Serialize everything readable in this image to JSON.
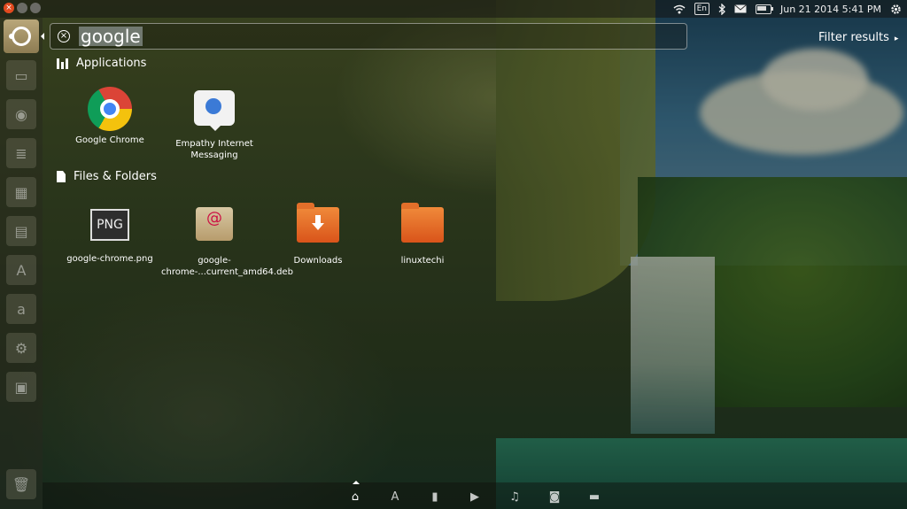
{
  "topbar": {
    "keyboard_layout": "En",
    "datetime": "Jun 21 2014  5:41 PM",
    "icons": [
      "wifi-icon",
      "keyboard-icon",
      "bluetooth-icon",
      "mail-icon",
      "battery-icon",
      "power-gear-icon"
    ]
  },
  "dash": {
    "search_query": "google",
    "filter_label": "Filter results"
  },
  "sections": {
    "applications": {
      "title": "Applications",
      "items": [
        {
          "label": "Google Chrome",
          "icon": "chrome-icon"
        },
        {
          "label": "Empathy Internet Messaging",
          "icon": "empathy-icon"
        }
      ]
    },
    "files": {
      "title": "Files & Folders",
      "items": [
        {
          "label": "google-chrome.png",
          "icon": "png-file-icon"
        },
        {
          "label": "google-chrome-...current_amd64.deb",
          "icon": "deb-package-icon"
        },
        {
          "label": "Downloads",
          "icon": "downloads-folder-icon"
        },
        {
          "label": "linuxtechi",
          "icon": "folder-icon"
        }
      ]
    }
  },
  "launcher": {
    "icons": [
      "ubuntu-dash-icon",
      "files-icon",
      "firefox-icon",
      "writer-icon",
      "calc-icon",
      "impress-icon",
      "software-center-icon",
      "amazon-icon",
      "settings-icon",
      "workspaces-icon",
      "trash-icon"
    ]
  },
  "lenses": [
    "home-lens-icon",
    "apps-lens-icon",
    "files-lens-icon",
    "video-lens-icon",
    "music-lens-icon",
    "photo-lens-icon",
    "social-lens-icon"
  ],
  "colors": {
    "accent_folder": "#e8652a",
    "launcher_bfb": "#a39266"
  }
}
